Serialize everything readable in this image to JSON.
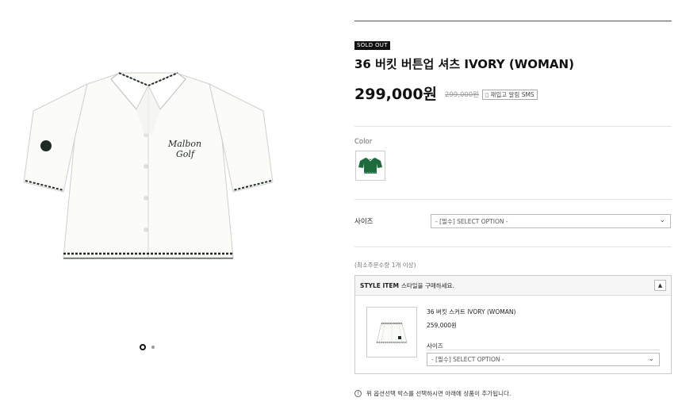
{
  "gallery": {
    "image_alt": "36 버킷 버튼업 셔츠 IVORY (WOMAN)",
    "shirt_logo_line1": "Malbon",
    "shirt_logo_line2": "Golf",
    "dots": {
      "count": 2,
      "active_index": 0
    }
  },
  "product": {
    "badge": "SOLD OUT",
    "title": "36 버킷 버튼업 셔츠 IVORY (WOMAN)",
    "price": "299,000원",
    "original_price": "299,000원",
    "sms_button": "재입고 알림 SMS",
    "sms_icon": "mobile-icon"
  },
  "color": {
    "label": "Color",
    "swatch_color": "#1d6b3c"
  },
  "size": {
    "label": "사이즈",
    "select_value": "- [필수] SELECT OPTION -"
  },
  "min_quantity": "(최소주문수량 1개 이상)",
  "style_item": {
    "header_bold": "STYLE ITEM",
    "header_text": "스타일을 구매하세요.",
    "collapse_icon": "chevron-up-icon",
    "product_name": "36 버킷 스커트 IVORY (WOMAN)",
    "product_price": "259,000원",
    "size_label": "사이즈",
    "size_select_value": "- [필수] SELECT OPTION -"
  },
  "notice": {
    "icon": "exclamation-icon",
    "text": "위 옵션선택 박스를 선택하시면 아래에 상품이 추가됩니다."
  },
  "colors": {
    "accent_green": "#1d6b3c",
    "shirt_ivory": "#fbfbf8",
    "trim_dark": "#1f2a24",
    "badge_black": "#111111"
  }
}
